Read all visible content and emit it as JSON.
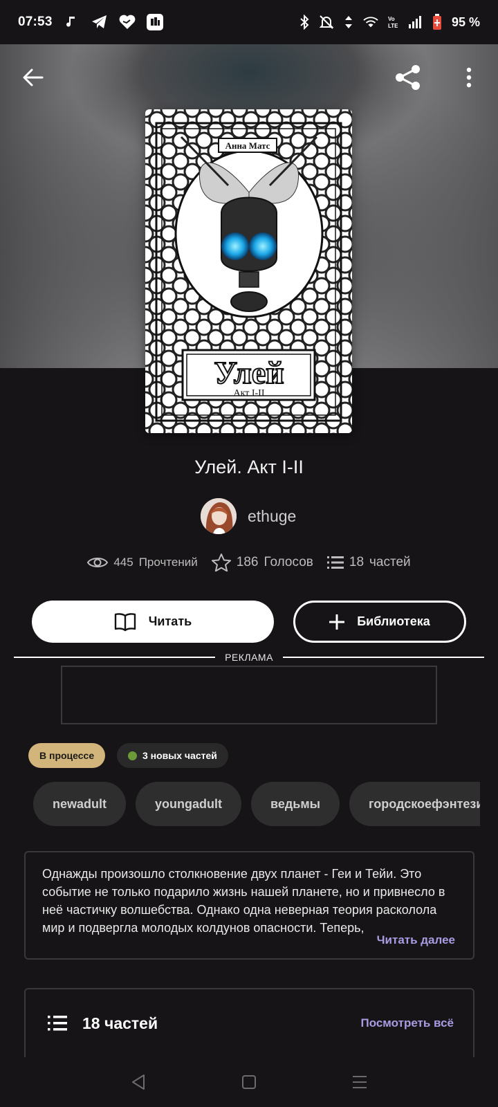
{
  "status_bar": {
    "time": "07:53",
    "battery": "95 %",
    "left_icons": [
      "music-note-icon",
      "telegram-icon",
      "heart-icon",
      "app-icon"
    ],
    "right_icons": [
      "bluetooth-icon",
      "bell-off-icon",
      "data-arrows-icon",
      "wifi-icon",
      "volte-icon",
      "signal-icon",
      "battery-icon"
    ]
  },
  "book": {
    "title": "Улей. Акт I-II",
    "cover": {
      "author": "Анна Матс",
      "title": "Улей",
      "subtitle": "Акт I-II"
    }
  },
  "author": {
    "name": "ethuge"
  },
  "stats": {
    "reads": "445",
    "reads_label": "Прочтений",
    "votes": "186",
    "votes_label": "Голосов",
    "parts": "18",
    "parts_label": "частей"
  },
  "actions": {
    "read": "Читать",
    "library": "Библиотека"
  },
  "ad": {
    "label": "РЕКЛАМА"
  },
  "badges": {
    "status": "В процессе",
    "new_parts": "3 новых частей"
  },
  "tags": [
    "newadult",
    "youngadult",
    "ведьмы",
    "городскоефэнтези"
  ],
  "description": {
    "text": "Однажды произошло столкновение двух планет - Геи и Тейи. Это событие не только подарило жизнь нашей планете, но и привнесло в неё частичку волшебства. Однако одна неверная теория расколола мир и подвергла молодых колдунов опасности. Теперь,",
    "read_more": "Читать далее"
  },
  "parts_section": {
    "title": "18 частей",
    "see_all": "Посмотреть всё"
  },
  "colors": {
    "accent": "#a99ce3",
    "status_badge": "#d1b57b",
    "new_dot": "#6d9a38",
    "background": "#161416"
  }
}
